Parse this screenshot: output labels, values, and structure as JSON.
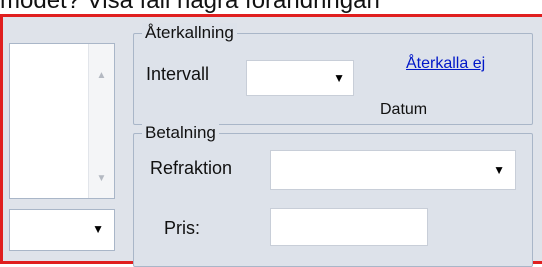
{
  "caption": {
    "text": "modet? Visa fall några förändringan"
  },
  "aterkallning": {
    "legend": "Återkallning",
    "intervall_label": "Intervall",
    "aterkalla_link": "Återkalla ej",
    "datum_label": "Datum"
  },
  "betalning": {
    "legend": "Betalning",
    "refraktion_label": "Refraktion",
    "pris_label": "Pris:"
  },
  "colors": {
    "highlight_border": "#e01f1f",
    "link": "#0017c8",
    "panel_bg": "#dfe3ea"
  },
  "icons": {
    "dropdown": "dropdown-arrow-icon",
    "scroll_up": "scroll-up-icon",
    "scroll_down": "scroll-down-icon"
  }
}
